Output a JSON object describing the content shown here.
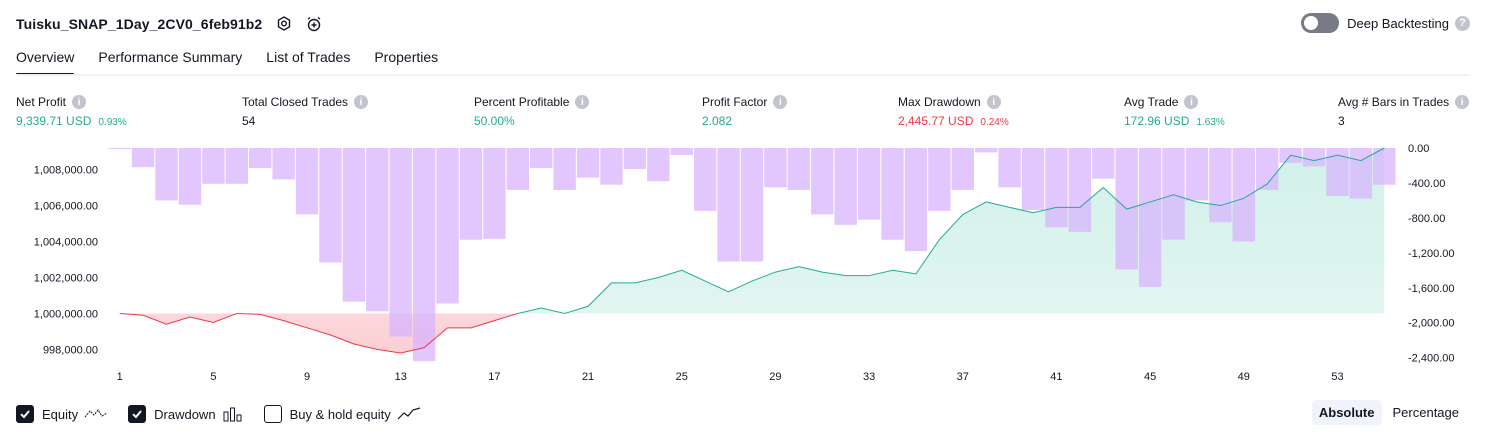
{
  "header": {
    "strategy_name": "Tuisku_SNAP_1Day_2CV0_6feb91b2",
    "deep_backtesting_label": "Deep Backtesting",
    "deep_backtesting_on": false
  },
  "tabs": [
    {
      "label": "Overview",
      "active": true
    },
    {
      "label": "Performance Summary",
      "active": false
    },
    {
      "label": "List of Trades",
      "active": false
    },
    {
      "label": "Properties",
      "active": false
    }
  ],
  "metrics": {
    "net_profit": {
      "label": "Net Profit",
      "value": "9,339.71 USD",
      "pct": "0.93%"
    },
    "total_closed_trades": {
      "label": "Total Closed Trades",
      "value": "54"
    },
    "percent_profitable": {
      "label": "Percent Profitable",
      "value": "50.00%"
    },
    "profit_factor": {
      "label": "Profit Factor",
      "value": "2.082"
    },
    "max_drawdown": {
      "label": "Max Drawdown",
      "value": "2,445.77 USD",
      "pct": "0.24%"
    },
    "avg_trade": {
      "label": "Avg Trade",
      "value": "172.96 USD",
      "pct": "1.63%"
    },
    "avg_bars": {
      "label": "Avg # Bars in Trades",
      "value": "3"
    }
  },
  "legend": {
    "equity": {
      "label": "Equity",
      "checked": true
    },
    "drawdown": {
      "label": "Drawdown",
      "checked": true
    },
    "buy_hold": {
      "label": "Buy & hold equity",
      "checked": false
    }
  },
  "modes": {
    "absolute": "Absolute",
    "percentage": "Percentage",
    "active": "absolute"
  },
  "colors": {
    "positive": "#22ab94",
    "negative": "#f23645",
    "drawdown_bar": "#d8b4fe",
    "equity_fill_pos": "#d1f0e9",
    "equity_fill_neg": "#fbcfd4"
  },
  "chart_data": {
    "type": "area",
    "x_ticks": [
      1,
      5,
      9,
      13,
      17,
      21,
      25,
      29,
      33,
      37,
      41,
      45,
      49,
      53
    ],
    "left_axis": {
      "ticks": [
        998000,
        1000000,
        1002000,
        1004000,
        1006000,
        1008000
      ],
      "tick_labels": [
        "998,000.00",
        "1,000,000.00",
        "1,002,000.00",
        "1,004,000.00",
        "1,006,000.00",
        "1,008,000.00"
      ],
      "range": [
        997300,
        1009200
      ]
    },
    "right_axis": {
      "ticks": [
        0,
        -400,
        -800,
        -1200,
        -1600,
        -2000,
        -2400
      ],
      "tick_labels": [
        "0.00",
        "-400.00",
        "-800.00",
        "-1,200.00",
        "-1,600.00",
        "-2,000.00",
        "-2,400.00"
      ],
      "range": [
        -2450,
        0
      ]
    },
    "baseline": 1000000,
    "series": [
      {
        "name": "Equity",
        "type": "line",
        "x": [
          1,
          2,
          3,
          4,
          5,
          6,
          7,
          8,
          9,
          10,
          11,
          12,
          13,
          14,
          15,
          16,
          17,
          18,
          19,
          20,
          21,
          22,
          23,
          24,
          25,
          26,
          27,
          28,
          29,
          30,
          31,
          32,
          33,
          34,
          35,
          36,
          37,
          38,
          39,
          40,
          41,
          42,
          43,
          44,
          45,
          46,
          47,
          48,
          49,
          50,
          51,
          52,
          53,
          54,
          55
        ],
        "values": [
          1000000,
          999900,
          999400,
          999800,
          999500,
          1000000,
          999950,
          999600,
          999200,
          998800,
          998300,
          998000,
          997800,
          998100,
          999200,
          999200,
          999600,
          1000000,
          1000300,
          1000000,
          1000400,
          1001700,
          1001700,
          1002000,
          1002400,
          1001800,
          1001200,
          1001800,
          1002300,
          1002600,
          1002300,
          1002100,
          1002100,
          1002400,
          1002200,
          1004100,
          1005500,
          1006200,
          1005900,
          1005600,
          1005900,
          1005900,
          1007000,
          1005800,
          1006200,
          1006600,
          1006200,
          1006000,
          1006400,
          1007200,
          1008800,
          1008500,
          1008800,
          1008500,
          1009200
        ]
      },
      {
        "name": "Drawdown",
        "type": "bar",
        "x": [
          1,
          2,
          3,
          4,
          5,
          6,
          7,
          8,
          9,
          10,
          11,
          12,
          13,
          14,
          15,
          16,
          17,
          18,
          19,
          20,
          21,
          22,
          23,
          24,
          25,
          26,
          27,
          28,
          29,
          30,
          31,
          32,
          33,
          34,
          35,
          36,
          37,
          38,
          39,
          40,
          41,
          42,
          43,
          44,
          45,
          46,
          47,
          48,
          49,
          50,
          51,
          52,
          53,
          54,
          55
        ],
        "values": [
          -10,
          -220,
          -600,
          -650,
          -410,
          -410,
          -230,
          -360,
          -760,
          -1310,
          -1760,
          -1870,
          -2160,
          -2440,
          -1780,
          -1050,
          -1040,
          -480,
          -230,
          -480,
          -340,
          -420,
          -240,
          -380,
          -80,
          -720,
          -1300,
          -1300,
          -450,
          -480,
          -760,
          -880,
          -820,
          -1050,
          -1180,
          -720,
          -480,
          -50,
          -450,
          -710,
          -910,
          -960,
          -350,
          -1390,
          -1590,
          -1050,
          -600,
          -850,
          -1070,
          -480,
          -170,
          -210,
          -550,
          -580,
          -420
        ]
      }
    ]
  }
}
